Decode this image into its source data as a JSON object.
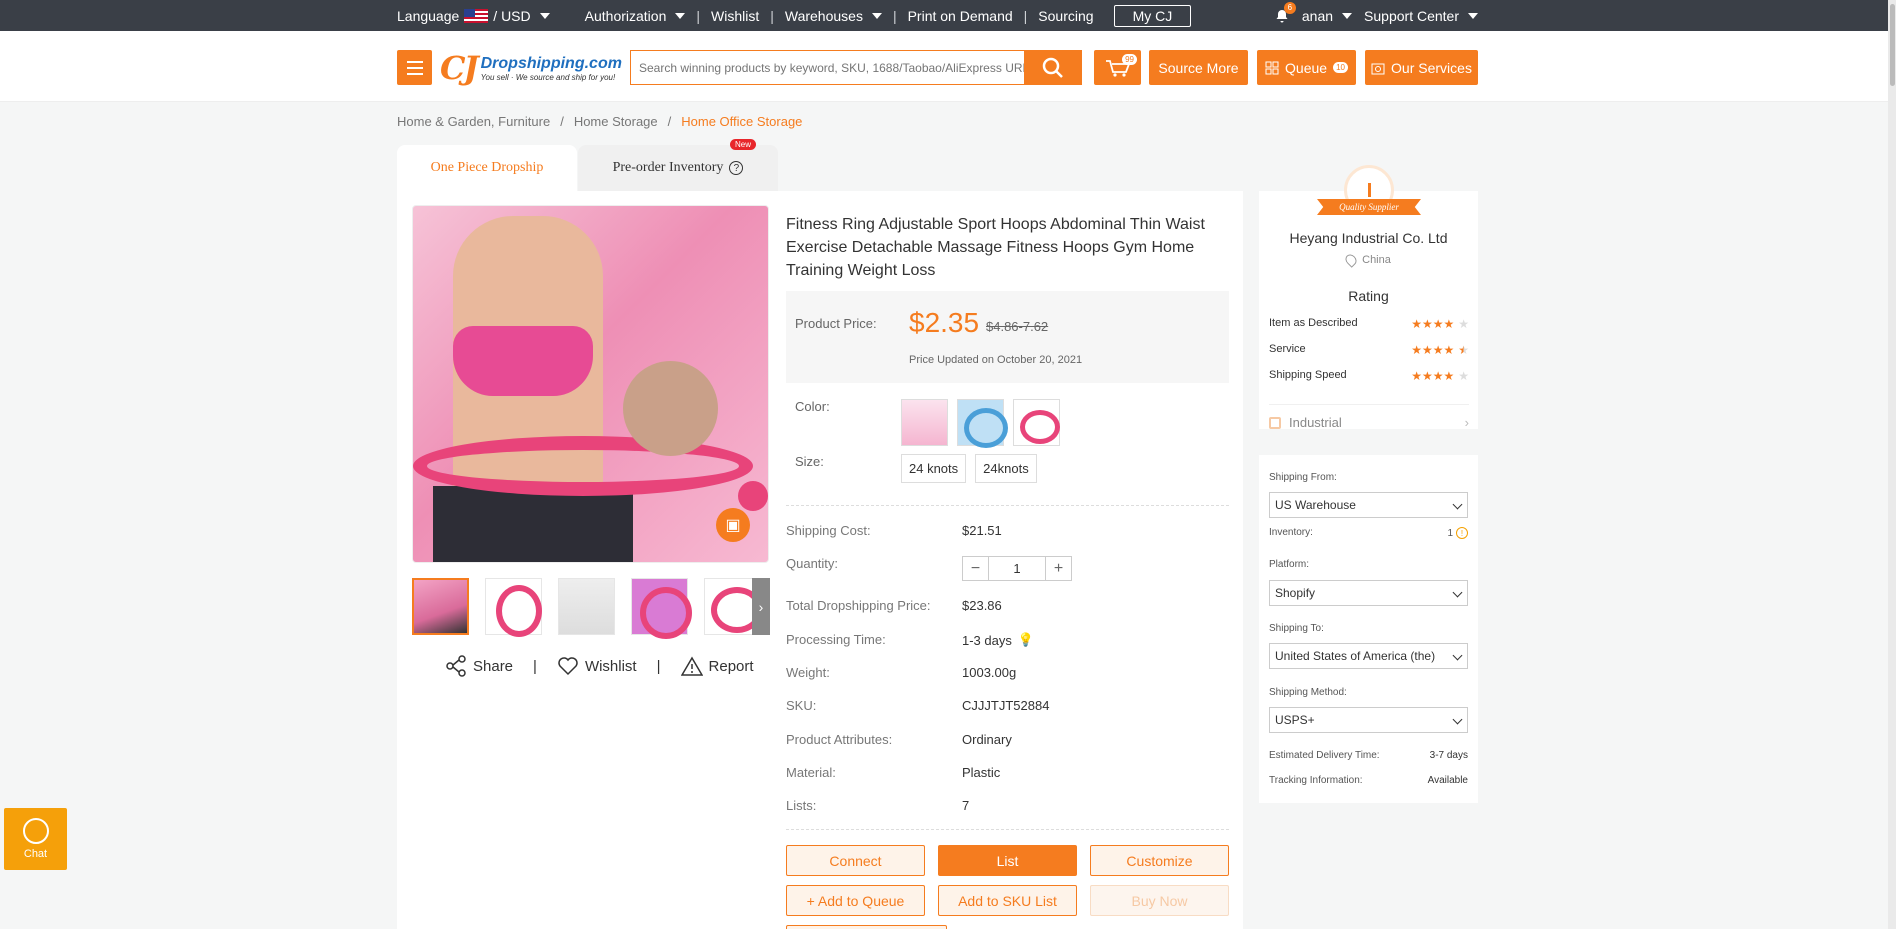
{
  "topbar": {
    "language": "Language",
    "currency": "/ USD",
    "authorization": "Authorization",
    "wishlist": "Wishlist",
    "warehouses": "Warehouses",
    "print_on_demand": "Print on Demand",
    "sourcing": "Sourcing",
    "my_cj": "My CJ",
    "notification_count": "6",
    "user": "anan",
    "support_center": "Support Center"
  },
  "header": {
    "logo_mark": "CJ",
    "logo_brand": "Dropshipping.com",
    "logo_slogan": "You sell · We source and ship for you!",
    "search_placeholder": "Search winning products by keyword, SKU, 1688/Taobao/AliExpress URL",
    "cart_count": "99",
    "source_more": "Source More",
    "queue": "Queue",
    "queue_count": "10",
    "our_services": "Our Services"
  },
  "breadcrumb": [
    "Home & Garden, Furniture",
    "Home Storage",
    "Home Office Storage"
  ],
  "tabs": {
    "one_piece": "One Piece Dropship",
    "pre_order": "Pre-order Inventory",
    "new_badge": "New"
  },
  "product": {
    "title": "Fitness Ring Adjustable Sport Hoops Abdominal Thin Waist Exercise Detachable Massage Fitness Hoops Gym Home Training Weight Loss",
    "price_label": "Product Price:",
    "price": "$2.35",
    "old_price": "$4.86-7.62",
    "price_updated": "Price Updated on October 20, 2021",
    "color_label": "Color:",
    "size_label": "Size:",
    "sizes": [
      "24 knots",
      "24knots"
    ],
    "shipping_cost_label": "Shipping Cost:",
    "shipping_cost": "$21.51",
    "quantity_label": "Quantity:",
    "quantity": "1",
    "total_label": "Total Dropshipping Price:",
    "total": "$23.86",
    "processing_label": "Processing Time:",
    "processing": "1-3 days",
    "weight_label": "Weight:",
    "weight": "1003.00g",
    "sku_label": "SKU:",
    "sku": "CJJJTJT52884",
    "attributes_label": "Product Attributes:",
    "attributes": "Ordinary",
    "material_label": "Material:",
    "material": "Plastic",
    "lists_label": "Lists:",
    "lists": "7"
  },
  "actions": {
    "share": "Share",
    "wishlist": "Wishlist",
    "report": "Report",
    "connect": "Connect",
    "list": "List",
    "customize": "Customize",
    "add_queue": "+ Add to Queue",
    "add_sku": "Add to SKU List",
    "buy_now": "Buy Now"
  },
  "supplier": {
    "badge": "Quality Supplier",
    "name": "Heyang Industrial Co. Ltd",
    "location": "China",
    "rating_title": "Rating",
    "ratings": [
      {
        "label": "Item as Described",
        "stars": 4
      },
      {
        "label": "Service",
        "stars": 4.5
      },
      {
        "label": "Shipping Speed",
        "stars": 4
      }
    ],
    "category": "Industrial"
  },
  "shipping": {
    "from_label": "Shipping From:",
    "from": "US Warehouse",
    "inventory_label": "Inventory:",
    "inventory": "1",
    "platform_label": "Platform:",
    "platform": "Shopify",
    "to_label": "Shipping To:",
    "to": "United States of America (the)",
    "method_label": "Shipping Method:",
    "method": "USPS+",
    "delivery_label": "Estimated Delivery Time:",
    "delivery": "3-7 days",
    "tracking_label": "Tracking Information:",
    "tracking": "Available"
  },
  "chat": {
    "label": "Chat"
  },
  "colors": {
    "accent": "#f57c1f",
    "topbar": "#3a3f47",
    "brand_blue": "#1f6fbf"
  }
}
